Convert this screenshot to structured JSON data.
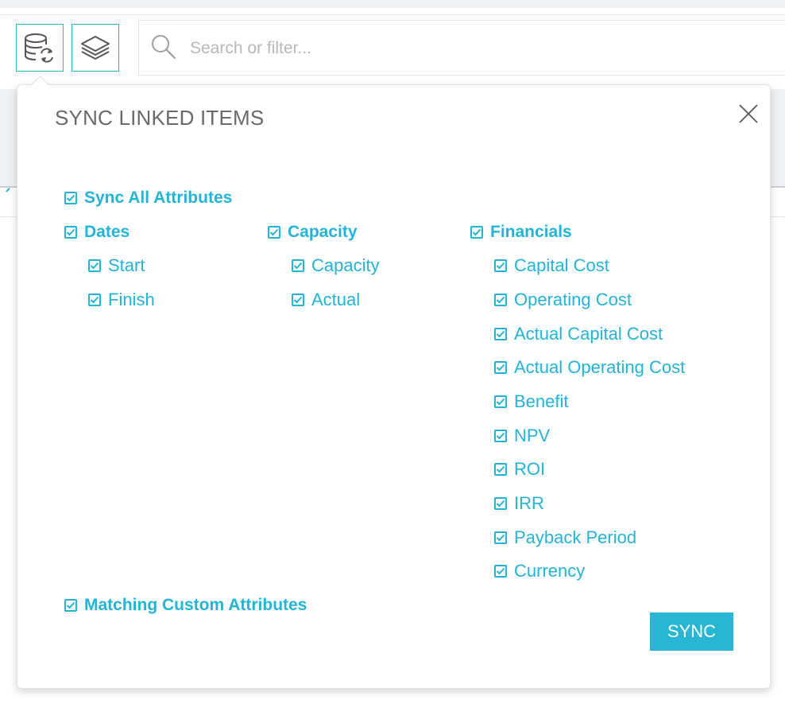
{
  "colors": {
    "accent": "#29b6d5",
    "title": "#666a6e",
    "placeholder": "#b4b8bd"
  },
  "toolbar": {
    "sync_icon": "database-sync-icon",
    "layers_icon": "layers-icon",
    "search": {
      "icon": "search-icon",
      "placeholder": "Search or filter...",
      "value": ""
    }
  },
  "popover": {
    "title": "SYNC LINKED ITEMS",
    "close_icon": "close-icon",
    "sync_all": {
      "label": "Sync All Attributes",
      "checked": true
    },
    "groups": [
      {
        "label": "Dates",
        "checked": true,
        "items": [
          {
            "label": "Start",
            "checked": true
          },
          {
            "label": "Finish",
            "checked": true
          }
        ]
      },
      {
        "label": "Capacity",
        "checked": true,
        "items": [
          {
            "label": "Capacity",
            "checked": true
          },
          {
            "label": "Actual",
            "checked": true
          }
        ]
      },
      {
        "label": "Financials",
        "checked": true,
        "items": [
          {
            "label": "Capital Cost",
            "checked": true
          },
          {
            "label": "Operating Cost",
            "checked": true
          },
          {
            "label": "Actual Capital Cost",
            "checked": true
          },
          {
            "label": "Actual Operating Cost",
            "checked": true
          },
          {
            "label": "Benefit",
            "checked": true
          },
          {
            "label": "NPV",
            "checked": true
          },
          {
            "label": "ROI",
            "checked": true
          },
          {
            "label": "IRR",
            "checked": true
          },
          {
            "label": "Payback Period",
            "checked": true
          },
          {
            "label": "Currency",
            "checked": true
          }
        ]
      }
    ],
    "matching_custom": {
      "label": "Matching Custom Attributes",
      "checked": true
    },
    "sync_button": "SYNC"
  }
}
